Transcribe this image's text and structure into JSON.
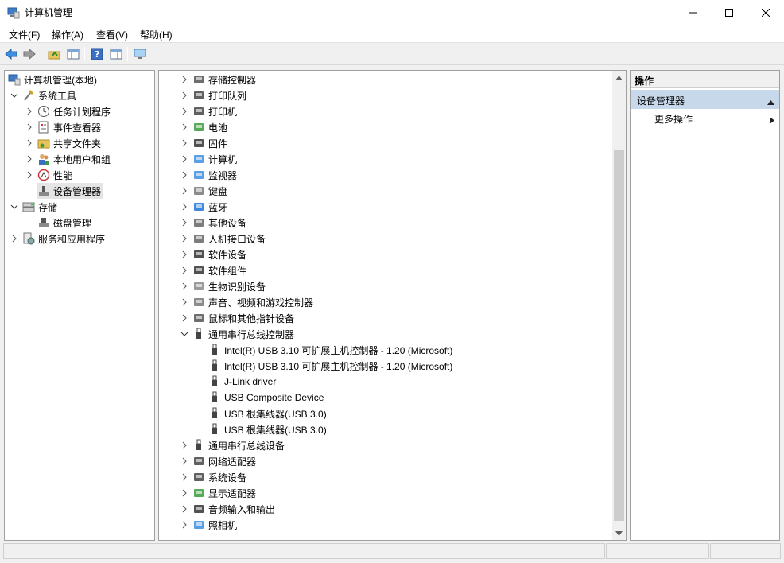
{
  "window": {
    "title": "计算机管理"
  },
  "menu": [
    "文件(F)",
    "操作(A)",
    "查看(V)",
    "帮助(H)"
  ],
  "toolbar": [
    "back-icon",
    "forward-icon",
    "up-folder-icon",
    "show-hide-tree-icon",
    "help-icon",
    "console-tree-icon",
    "monitor-icon"
  ],
  "tree": {
    "root": "计算机管理(本地)",
    "system_tools": "系统工具",
    "task_scheduler": "任务计划程序",
    "event_viewer": "事件查看器",
    "shared_folders": "共享文件夹",
    "local_users": "本地用户和组",
    "performance": "性能",
    "device_manager": "设备管理器",
    "storage": "存储",
    "disk_management": "磁盘管理",
    "services_apps": "服务和应用程序"
  },
  "devices": {
    "categories_top": [
      "存储控制器",
      "打印队列",
      "打印机",
      "电池",
      "固件",
      "计算机",
      "监视器",
      "键盘",
      "蓝牙",
      "其他设备",
      "人机接口设备",
      "软件设备",
      "软件组件",
      "生物识别设备",
      "声音、视频和游戏控制器",
      "鼠标和其他指针设备"
    ],
    "usb_controllers": "通用串行总线控制器",
    "usb_children": [
      "Intel(R) USB 3.10 可扩展主机控制器 - 1.20 (Microsoft)",
      "Intel(R) USB 3.10 可扩展主机控制器 - 1.20 (Microsoft)",
      "J-Link driver",
      "USB Composite Device",
      "USB 根集线器(USB 3.0)",
      "USB 根集线器(USB 3.0)"
    ],
    "categories_bottom": [
      "通用串行总线设备",
      "网络适配器",
      "系统设备",
      "显示适配器",
      "音频输入和输出",
      "照相机"
    ]
  },
  "actions": {
    "header": "操作",
    "section": "设备管理器",
    "more": "更多操作"
  }
}
